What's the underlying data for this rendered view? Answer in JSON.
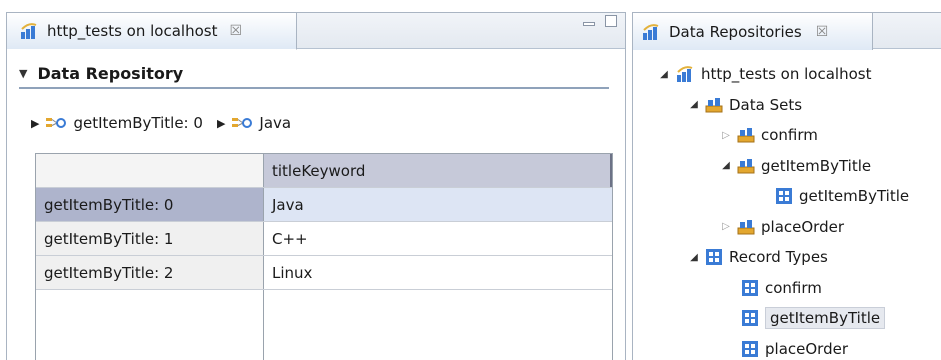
{
  "left_panel": {
    "tab_title": "http_tests on localhost",
    "tab_close": "☒",
    "section_title": "Data Repository",
    "breadcrumb": [
      "getItemByTitle: 0",
      "Java"
    ],
    "table": {
      "column_headers": [
        "titleKeyword"
      ],
      "rows": [
        {
          "label": "getItemByTitle: 0",
          "value": "Java",
          "selected": true
        },
        {
          "label": "getItemByTitle: 1",
          "value": "C++",
          "selected": false
        },
        {
          "label": "getItemByTitle: 2",
          "value": "Linux",
          "selected": false
        }
      ]
    }
  },
  "right_panel": {
    "tab_title": "Data Repositories",
    "tab_close": "☒",
    "tree": {
      "root": "http_tests on localhost",
      "data_sets_label": "Data Sets",
      "data_sets": [
        "confirm",
        "getItemByTitle",
        "getItemByTitle",
        "placeOrder"
      ],
      "record_types_label": "Record Types",
      "record_types": [
        "confirm",
        "getItemByTitle",
        "placeOrder"
      ]
    }
  }
}
